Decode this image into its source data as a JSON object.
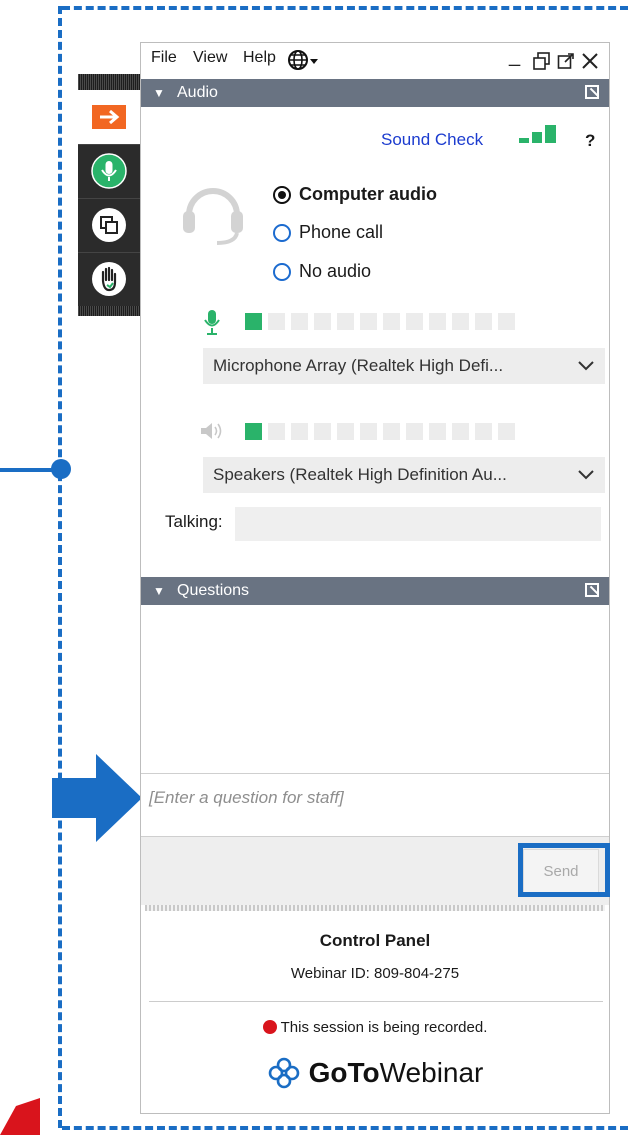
{
  "menu": {
    "file": "File",
    "view": "View",
    "help": "Help"
  },
  "audio": {
    "header": "Audio",
    "sound_check": "Sound Check",
    "help_mark": "?",
    "options": [
      "Computer audio",
      "Phone call",
      "No audio"
    ],
    "selected": "Computer audio",
    "microphone": "Microphone Array (Realtek High Defi...",
    "speakers": "Speakers (Realtek High Definition Au...",
    "mic_level": 1,
    "speaker_level": 1,
    "meter_segments": 12,
    "talking_label": "Talking:",
    "talking_value": ""
  },
  "questions": {
    "header": "Questions",
    "placeholder": "[Enter a question for staff]",
    "send_label": "Send"
  },
  "control_panel": {
    "title": "Control Panel",
    "webinar_id": "Webinar ID: 809-804-275",
    "recording_notice": "This session is being recorded.",
    "logo_bold": "GoTo",
    "logo_light": "Webinar"
  },
  "toolbar": {
    "icons": [
      "arrow-right-icon",
      "microphone-icon",
      "screens-icon",
      "raise-hand-icon"
    ]
  },
  "colors": {
    "accent_blue": "#1a6dc4",
    "header_gray": "#697382",
    "meter_green": "#2ab36a",
    "arrow_orange": "#f26722",
    "record_red": "#d9141c"
  }
}
